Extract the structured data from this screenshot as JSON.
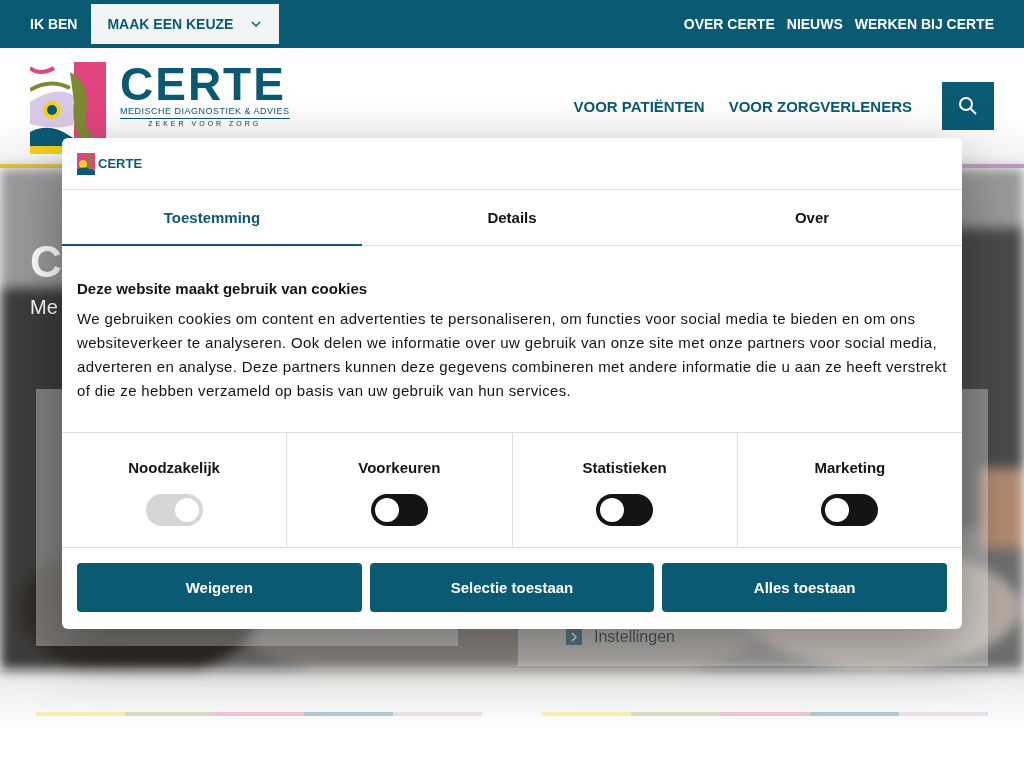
{
  "top_bar": {
    "label": "IK BEN",
    "dropdown": "MAAK EEN KEUZE",
    "links": [
      "OVER CERTE",
      "NIEUWS",
      "WERKEN BIJ CERTE"
    ]
  },
  "header": {
    "logo": {
      "name": "CERTE",
      "tagline": "MEDISCHE DIAGNOSTIEK & ADVIES",
      "slogan": "ZEKER VOOR ZORG"
    },
    "nav": [
      "VOOR PATIËNTEN",
      "VOOR ZORGVERLENERS"
    ]
  },
  "hero": {
    "title": "C",
    "subtitle": "Me",
    "card_link": "Instellingen"
  },
  "stripes": [
    {
      "color": "#f8eeb4"
    },
    {
      "color": "#d6dcc2"
    },
    {
      "color": "#f0c4d4"
    },
    {
      "color": "#b2c9d2"
    },
    {
      "color": "#ebdfea"
    }
  ],
  "cookie_dialog": {
    "logo": "CERTE",
    "tabs": [
      {
        "label": "Toestemming",
        "selected": true
      },
      {
        "label": "Details",
        "selected": false
      },
      {
        "label": "Over",
        "selected": false
      }
    ],
    "heading": "Deze website maakt gebruik van cookies",
    "text": "We gebruiken cookies om content en advertenties te personaliseren, om functies voor social media te bieden en om ons websiteverkeer te analyseren. Ook delen we informatie over uw gebruik van onze site met onze partners voor social media, adverteren en analyse. Deze partners kunnen deze gegevens combineren met andere informatie die u aan ze heeft verstrekt of die ze hebben verzameld op basis van uw gebruik van hun services.",
    "categories": [
      {
        "label": "Noodzakelijk",
        "checked": true,
        "disabled": true
      },
      {
        "label": "Voorkeuren",
        "checked": false,
        "disabled": false
      },
      {
        "label": "Statistieken",
        "checked": false,
        "disabled": false
      },
      {
        "label": "Marketing",
        "checked": false,
        "disabled": false
      }
    ],
    "buttons": [
      "Weigeren",
      "Selectie toestaan",
      "Alles toestaan"
    ]
  }
}
